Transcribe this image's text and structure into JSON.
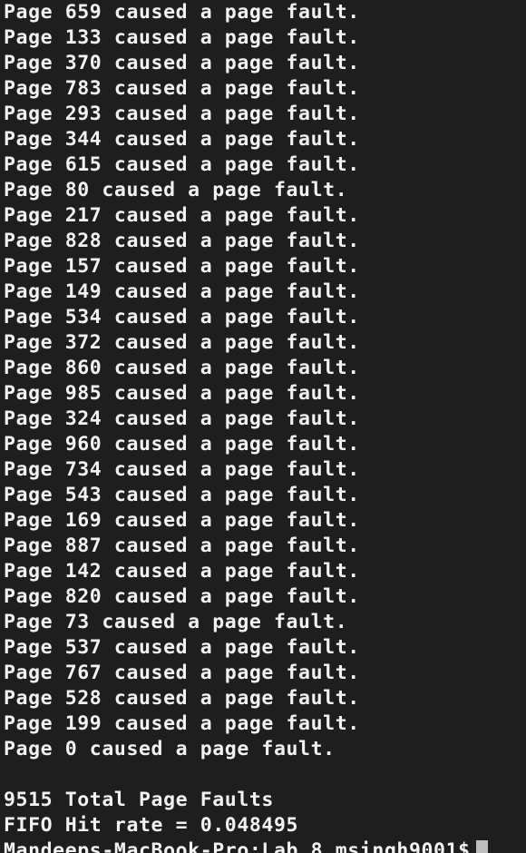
{
  "terminal": {
    "output_lines": [
      "Page 659 caused a page fault.",
      "Page 133 caused a page fault.",
      "Page 370 caused a page fault.",
      "Page 783 caused a page fault.",
      "Page 293 caused a page fault.",
      "Page 344 caused a page fault.",
      "Page 615 caused a page fault.",
      "Page 80 caused a page fault.",
      "Page 217 caused a page fault.",
      "Page 828 caused a page fault.",
      "Page 157 caused a page fault.",
      "Page 149 caused a page fault.",
      "Page 534 caused a page fault.",
      "Page 372 caused a page fault.",
      "Page 860 caused a page fault.",
      "Page 985 caused a page fault.",
      "Page 324 caused a page fault.",
      "Page 960 caused a page fault.",
      "Page 734 caused a page fault.",
      "Page 543 caused a page fault.",
      "Page 169 caused a page fault.",
      "Page 887 caused a page fault.",
      "Page 142 caused a page fault.",
      "Page 820 caused a page fault.",
      "Page 73 caused a page fault.",
      "Page 537 caused a page fault.",
      "Page 767 caused a page fault.",
      "Page 528 caused a page fault.",
      "Page 199 caused a page fault.",
      "Page 0 caused a page fault."
    ],
    "total_faults_line": "9515 Total Page Faults",
    "hit_rate_line": "FIFO Hit rate = 0.048495",
    "prompt": "Mandeeps-MacBook-Pro:Lab 8 msingh9001$"
  }
}
